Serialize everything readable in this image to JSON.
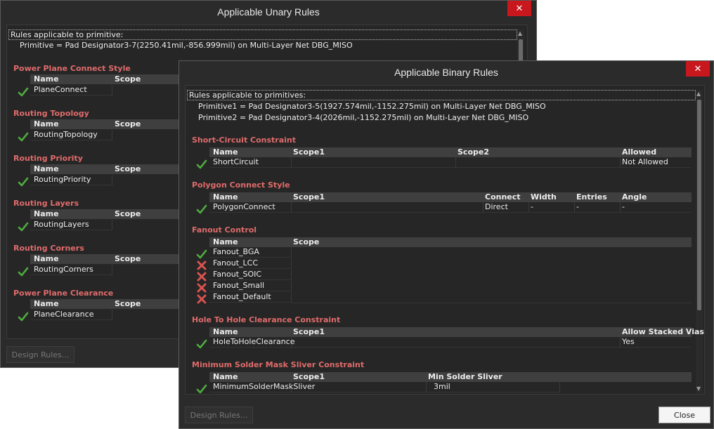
{
  "unary": {
    "title": "Applicable Unary Rules",
    "close_glyph": "✕",
    "header": "Rules applicable to primitive:",
    "primitive": "Primitive = Pad Designator3-7(2250.41mil,-856.999mil) on Multi-Layer Net DBG_MISO",
    "design_rules_label": "Design Rules...",
    "sections": [
      {
        "title": "Power Plane Connect Style",
        "col_name": "Name",
        "col_scope": "Scope",
        "rule": "PlaneConnect"
      },
      {
        "title": "Routing Topology",
        "col_name": "Name",
        "col_scope": "Scope",
        "rule": "RoutingTopology"
      },
      {
        "title": "Routing Priority",
        "col_name": "Name",
        "col_scope": "Scope",
        "rule": "RoutingPriority"
      },
      {
        "title": "Routing Layers",
        "col_name": "Name",
        "col_scope": "Scope",
        "rule": "RoutingLayers"
      },
      {
        "title": "Routing Corners",
        "col_name": "Name",
        "col_scope": "Scope",
        "rule": "RoutingCorners"
      },
      {
        "title": "Power Plane Clearance",
        "col_name": "Name",
        "col_scope": "Scope",
        "rule": "PlaneClearance"
      }
    ]
  },
  "binary": {
    "title": "Applicable Binary Rules",
    "close_glyph": "✕",
    "header": "Rules applicable to primitives:",
    "primitive1": "Primitive1 = Pad Designator3-5(1927.574mil,-1152.275mil) on Multi-Layer Net DBG_MISO",
    "primitive2": "Primitive2 = Pad Designator3-4(2026mil,-1152.275mil) on Multi-Layer Net DBG_MISO",
    "design_rules_label": "Design Rules...",
    "close_label": "Close",
    "short": {
      "title": "Short-Circuit Constraint",
      "cols": [
        "Name",
        "Scope1",
        "Scope2",
        "Allowed"
      ],
      "rule": "ShortCircuit",
      "allowed": "Not Allowed"
    },
    "polygon": {
      "title": "Polygon Connect Style",
      "cols": [
        "Name",
        "Scope1",
        "Connect",
        "Width",
        "Entries",
        "Angle"
      ],
      "rule": "PolygonConnect",
      "connect": "Direct",
      "width": "-",
      "entries": "-",
      "angle": "-"
    },
    "fanout": {
      "title": "Fanout Control",
      "cols": [
        "Name",
        "Scope"
      ],
      "rules": [
        "Fanout_BGA",
        "Fanout_LCC",
        "Fanout_SOIC",
        "Fanout_Small",
        "Fanout_Default"
      ]
    },
    "hole": {
      "title": "Hole To Hole Clearance Constraint",
      "cols": [
        "Name",
        "Scope1",
        "Allow Stacked Vias"
      ],
      "rule": "HoleToHoleClearance",
      "allow": "Yes"
    },
    "mask": {
      "title": "Minimum Solder Mask Sliver Constraint",
      "cols": [
        "Name",
        "Scope1",
        "Min Solder Sliver"
      ],
      "rule": "MinimumSolderMaskSliver",
      "value": "3mil"
    }
  },
  "colors": {
    "check": "#4fae3f",
    "cross": "#d9534f",
    "section": "#e06b6b",
    "close_red": "#c8171d"
  }
}
